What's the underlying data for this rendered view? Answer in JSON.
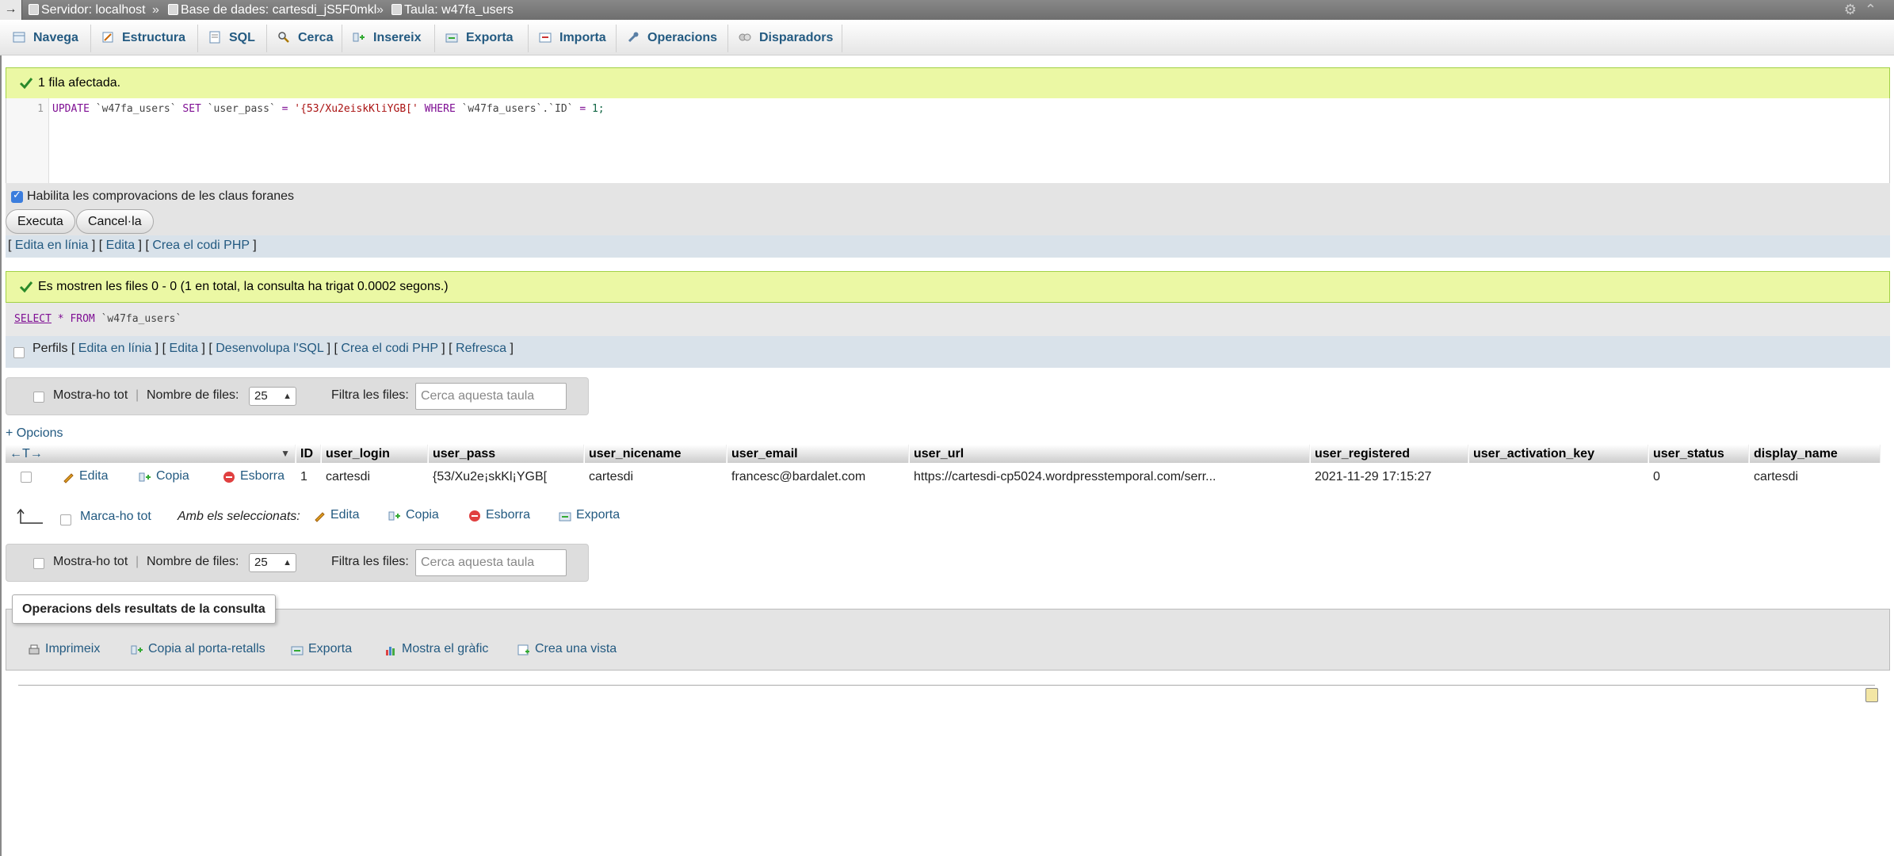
{
  "breadcrumb": {
    "server": "Servidor: localhost",
    "database": "Base de dades: cartesdi_jS5F0mkl",
    "table": "Taula: w47fa_users",
    "separator": "»"
  },
  "tabs": [
    {
      "label": "Navega",
      "icon": "browse-icon"
    },
    {
      "label": "Estructura",
      "icon": "structure-icon"
    },
    {
      "label": "SQL",
      "icon": "sql-icon"
    },
    {
      "label": "Cerca",
      "icon": "search-icon"
    },
    {
      "label": "Insereix",
      "icon": "insert-icon"
    },
    {
      "label": "Exporta",
      "icon": "export-icon"
    },
    {
      "label": "Importa",
      "icon": "import-icon"
    },
    {
      "label": "Operacions",
      "icon": "wrench-icon"
    },
    {
      "label": "Disparadors",
      "icon": "triggers-icon"
    }
  ],
  "update_result": {
    "message": "1 fila afectada.",
    "line_number": "1",
    "sql": {
      "kw_update": "UPDATE",
      "table": "`w47fa_users`",
      "kw_set": "SET",
      "column": "`user_pass`",
      "eq": "=",
      "value": "'{53/Xu2eiskKliYGB['",
      "kw_where": "WHERE",
      "where_col": "`w47fa_users`.`ID`",
      "eq2": "=",
      "num": "1;"
    },
    "fk_label": "Habilita les comprovacions de les claus foranes",
    "execute_label": "Executa",
    "cancel_label": "Cancel·la",
    "links": {
      "inline_edit": "Edita en línia",
      "edit": "Edita",
      "php": "Crea el codi PHP"
    }
  },
  "select_result": {
    "message": "Es mostren les files 0 - 0 (1 en total, la consulta ha trigat 0.0002 segons.)",
    "sql_select": "SELECT",
    "sql_star": "*",
    "sql_from": "FROM",
    "sql_table": "`w47fa_users`",
    "profile_label": "Perfils",
    "links": {
      "inline_edit": "Edita en línia",
      "edit": "Edita",
      "explain": "Desenvolupa l'SQL",
      "php": "Crea el codi PHP",
      "refresh": "Refresca"
    }
  },
  "navigation": {
    "show_all": "Mostra-ho tot",
    "rows_label": "Nombre de files:",
    "rows_value": "25",
    "filter_label": "Filtra les files:",
    "filter_placeholder": "Cerca aquesta taula"
  },
  "options_link": "+ Opcions",
  "table": {
    "columns": [
      "ID",
      "user_login",
      "user_pass",
      "user_nicename",
      "user_email",
      "user_url",
      "user_registered",
      "user_activation_key",
      "user_status",
      "display_name"
    ],
    "row_actions": {
      "edit": "Edita",
      "copy": "Copia",
      "delete": "Esborra"
    },
    "rows": [
      {
        "ID": "1",
        "user_login": "cartesdi",
        "user_pass": "{53/Xu2e¡skKl¡YGB[",
        "user_nicename": "cartesdi",
        "user_email": "francesc@bardalet.com",
        "user_url": "https://cartesdi-cp5024.wordpresstemporal.com/serr...",
        "user_registered": "2021-11-29 17:15:27",
        "user_activation_key": "",
        "user_status": "0",
        "display_name": "cartesdi"
      }
    ]
  },
  "bulk": {
    "check_all": "Marca-ho tot",
    "with_selected": "Amb els seleccionats:",
    "edit": "Edita",
    "copy": "Copia",
    "delete": "Esborra",
    "export": "Exporta"
  },
  "query_ops": {
    "legend": "Operacions dels resultats de la consulta",
    "print": "Imprimeix",
    "copy_clipboard": "Copia al porta-retalls",
    "export": "Exporta",
    "chart": "Mostra el gràfic",
    "view": "Crea una vista"
  },
  "colors": {
    "link": "#235a81",
    "success_bg": "#ebf8a4",
    "success_border": "#a2d246",
    "topbar": "#7a7a7a"
  }
}
